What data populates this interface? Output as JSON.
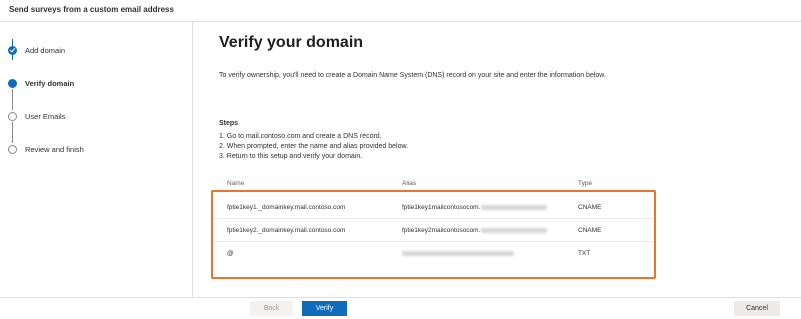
{
  "topbar": {
    "title": "Send surveys from a custom email address"
  },
  "wizard": {
    "steps": [
      {
        "label": "Add domain",
        "state": "done"
      },
      {
        "label": "Verify domain",
        "state": "current"
      },
      {
        "label": "User Emails",
        "state": "pending"
      },
      {
        "label": "Review and finish",
        "state": "pending"
      }
    ]
  },
  "main": {
    "heading": "Verify your domain",
    "intro": "To verify ownership, you'll need to create a Domain Name System (DNS) record on your site and enter the information below.",
    "steps_title": "Steps",
    "steps": [
      "1. Go to mail.contoso.com and create a DNS record.",
      "2. When prompted, enter the name and alias provided below.",
      "3. Return to this setup and verify your domain."
    ]
  },
  "table": {
    "headers": {
      "name": "Name",
      "alias": "Alias",
      "type": "Type"
    },
    "rows": [
      {
        "name": "fptie1key1._domainkey.mail.contoso.com",
        "alias": "fptie1key1mailcontosocom.",
        "type": "CNAME"
      },
      {
        "name": "fptie1key2._domainkey.mail.contoso.com",
        "alias": "fptie1key2mailcontosocom.",
        "type": "CNAME"
      },
      {
        "name": "@",
        "alias": "",
        "type": "TXT"
      }
    ]
  },
  "footer": {
    "back_label": "Back",
    "verify_label": "Verify",
    "cancel_label": "Cancel"
  },
  "colors": {
    "accent": "#0f6cbd",
    "highlight": "#e8742f"
  }
}
